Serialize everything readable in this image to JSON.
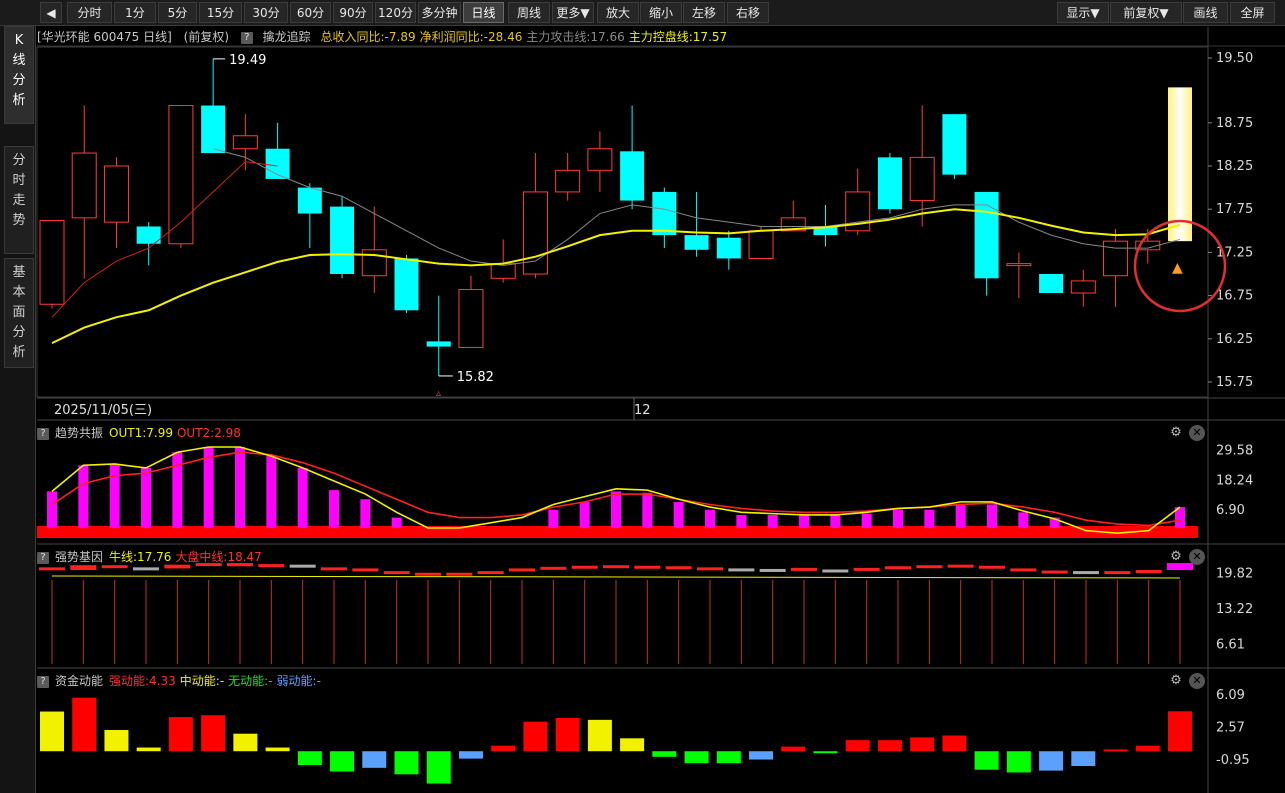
{
  "toolbar": {
    "back_icon": "play-left-icon",
    "periods": [
      "分时",
      "1分",
      "5分",
      "15分",
      "30分",
      "60分",
      "90分",
      "120分",
      "多分钟",
      "日线",
      "周线",
      "更多▼"
    ],
    "active_period": "日线",
    "actions": [
      "放大",
      "缩小",
      "左移",
      "右移"
    ],
    "right": [
      "显示▼",
      "前复权▼",
      "画线",
      "全屏"
    ]
  },
  "sidebar": {
    "tabs": [
      "K线分析",
      "分时走势",
      "基本面分析"
    ],
    "active": "K线分析"
  },
  "main_panel": {
    "title": "[华光环能 600475 日线]",
    "adjust": "(前复权)",
    "indicator_name": "擒龙追踪",
    "items": [
      {
        "label": "总收入同比:-7.89",
        "color": "#e6c619"
      },
      {
        "label": "净利润同比:-28.46",
        "color": "#e6c619"
      },
      {
        "label": "主力攻击线:17.66",
        "color": "#8a8a8a"
      },
      {
        "label": "主力控盘线:17.57",
        "color": "#f2f200"
      }
    ],
    "date_label": "2025/11/05(三)",
    "month_label": "12",
    "high_label": "19.49",
    "low_label": "15.82",
    "y_ticks": [
      "19.50",
      "18.75",
      "18.25",
      "17.75",
      "17.25",
      "16.75",
      "16.25",
      "15.75"
    ]
  },
  "sub1": {
    "name": "趋势共振",
    "items": [
      {
        "label": "OUT1:7.99",
        "color": "#f2f200"
      },
      {
        "label": "OUT2:2.98",
        "color": "#ff3030"
      }
    ],
    "y_ticks": [
      "29.58",
      "18.24",
      "6.90"
    ]
  },
  "sub2": {
    "name": "强势基因",
    "items": [
      {
        "label": "牛线:17.76",
        "color": "#f2f200"
      },
      {
        "label": "大盘中线:18.47",
        "color": "#ff3030"
      }
    ],
    "y_ticks": [
      "19.82",
      "13.22",
      "6.61"
    ]
  },
  "sub3": {
    "name": "资金动能",
    "items": [
      {
        "label": "强动能:4.33",
        "color": "#ff3030"
      },
      {
        "label": "中动能:-",
        "color": "#f2f200"
      },
      {
        "label": "无动能:-",
        "color": "#22dd22"
      },
      {
        "label": "弱动能:-",
        "color": "#5aa0ff"
      }
    ],
    "y_ticks": [
      "6.09",
      "2.57",
      "-0.95"
    ]
  },
  "chart_data": [
    {
      "type": "candlestick",
      "title": "华光环能 600475 日线",
      "ylim": [
        15.7,
        19.65
      ],
      "y_ticks": [
        19.5,
        18.75,
        18.25,
        17.75,
        17.25,
        16.75,
        16.25,
        15.75
      ],
      "candles": [
        {
          "o": 16.65,
          "c": 17.62,
          "h": 17.62,
          "l": 16.6
        },
        {
          "o": 17.65,
          "c": 18.4,
          "h": 18.95,
          "l": 16.95
        },
        {
          "o": 17.6,
          "c": 18.25,
          "h": 18.35,
          "l": 17.3
        },
        {
          "o": 17.55,
          "c": 17.35,
          "h": 17.6,
          "l": 17.1
        },
        {
          "o": 17.35,
          "c": 18.95,
          "h": 18.95,
          "l": 17.3
        },
        {
          "o": 18.95,
          "c": 18.4,
          "h": 19.49,
          "l": 18.4
        },
        {
          "o": 18.45,
          "c": 18.6,
          "h": 18.85,
          "l": 18.2
        },
        {
          "o": 18.45,
          "c": 18.1,
          "h": 18.75,
          "l": 18.1
        },
        {
          "o": 18.0,
          "c": 17.7,
          "h": 18.05,
          "l": 17.3
        },
        {
          "o": 17.78,
          "c": 17.0,
          "h": 17.9,
          "l": 16.95
        },
        {
          "o": 16.98,
          "c": 17.28,
          "h": 17.78,
          "l": 16.78
        },
        {
          "o": 17.18,
          "c": 16.58,
          "h": 17.22,
          "l": 16.55
        },
        {
          "o": 16.22,
          "c": 16.16,
          "h": 16.75,
          "l": 15.82
        },
        {
          "o": 16.15,
          "c": 16.82,
          "h": 16.98,
          "l": 16.15
        },
        {
          "o": 16.95,
          "c": 17.12,
          "h": 17.4,
          "l": 16.9
        },
        {
          "o": 17.0,
          "c": 17.95,
          "h": 18.4,
          "l": 16.95
        },
        {
          "o": 17.95,
          "c": 18.2,
          "h": 18.4,
          "l": 17.85
        },
        {
          "o": 18.2,
          "c": 18.45,
          "h": 18.65,
          "l": 17.95
        },
        {
          "o": 18.42,
          "c": 17.85,
          "h": 18.95,
          "l": 17.75
        },
        {
          "o": 17.95,
          "c": 17.45,
          "h": 18.0,
          "l": 17.3
        },
        {
          "o": 17.45,
          "c": 17.28,
          "h": 17.95,
          "l": 17.2
        },
        {
          "o": 17.42,
          "c": 17.18,
          "h": 17.5,
          "l": 17.05
        },
        {
          "o": 17.18,
          "c": 17.5,
          "h": 17.55,
          "l": 17.18
        },
        {
          "o": 17.5,
          "c": 17.65,
          "h": 17.85,
          "l": 17.5
        },
        {
          "o": 17.55,
          "c": 17.45,
          "h": 17.8,
          "l": 17.32
        },
        {
          "o": 17.5,
          "c": 17.95,
          "h": 18.22,
          "l": 17.45
        },
        {
          "o": 18.35,
          "c": 17.75,
          "h": 18.4,
          "l": 17.7
        },
        {
          "o": 17.85,
          "c": 18.35,
          "h": 18.95,
          "l": 17.55
        },
        {
          "o": 18.85,
          "c": 18.15,
          "h": 18.85,
          "l": 18.1
        },
        {
          "o": 17.95,
          "c": 16.95,
          "h": 17.95,
          "l": 16.75
        },
        {
          "o": 17.12,
          "c": 17.12,
          "h": 17.25,
          "l": 16.72
        },
        {
          "o": 17.0,
          "c": 16.78,
          "h": 17.0,
          "l": 16.78
        },
        {
          "o": 16.78,
          "c": 16.92,
          "h": 17.05,
          "l": 16.62
        },
        {
          "o": 16.98,
          "c": 17.38,
          "h": 17.52,
          "l": 16.62
        },
        {
          "o": 17.28,
          "c": 17.38,
          "h": 17.52,
          "l": 17.12
        },
        {
          "o": 17.38,
          "c": 19.16,
          "h": 19.16,
          "l": 17.38
        }
      ],
      "ma_attack": [
        null,
        null,
        null,
        null,
        null,
        18.45,
        18.35,
        18.15,
        18.0,
        17.9,
        17.7,
        17.5,
        17.3,
        17.15,
        17.1,
        17.15,
        17.4,
        17.7,
        17.8,
        17.75,
        17.65,
        17.6,
        17.55,
        17.55,
        17.55,
        17.6,
        17.65,
        17.75,
        17.8,
        17.8,
        17.6,
        17.45,
        17.35,
        17.3,
        17.3,
        17.4
      ],
      "ma_control": [
        16.2,
        16.38,
        16.5,
        16.58,
        16.75,
        16.9,
        17.02,
        17.14,
        17.22,
        17.23,
        17.22,
        17.17,
        17.12,
        17.1,
        17.12,
        17.2,
        17.32,
        17.45,
        17.5,
        17.5,
        17.48,
        17.47,
        17.5,
        17.52,
        17.54,
        17.58,
        17.63,
        17.7,
        17.75,
        17.72,
        17.65,
        17.56,
        17.48,
        17.45,
        17.46,
        17.57
      ]
    },
    {
      "type": "bar",
      "title": "趋势共振",
      "ylim": [
        0,
        33
      ],
      "values": [
        14,
        24,
        24.5,
        23,
        29,
        31,
        31,
        27.5,
        23,
        14.5,
        11,
        4,
        2,
        2,
        2,
        2,
        7,
        10,
        14,
        13.5,
        10,
        7,
        5,
        5,
        5,
        5,
        5.5,
        7,
        7,
        9,
        9,
        6,
        4,
        2,
        1,
        2,
        8
      ],
      "out1": [
        14,
        24,
        24.5,
        23,
        29,
        31,
        31,
        27.5,
        23,
        18,
        13,
        6,
        0,
        0,
        2,
        4,
        9,
        12,
        15,
        14.5,
        11,
        8,
        6,
        5.5,
        5,
        5,
        6,
        7.5,
        8,
        10,
        10,
        6.5,
        3.5,
        -1,
        -2,
        -1,
        7.99
      ],
      "out2": [
        9,
        17,
        20,
        21,
        24,
        27,
        29,
        28,
        25,
        21,
        16,
        11,
        6,
        4,
        4,
        5,
        8,
        10,
        13,
        13,
        11,
        9,
        7.5,
        6.5,
        6,
        6,
        6.5,
        7.5,
        8,
        9,
        9.5,
        8,
        6,
        3,
        1.5,
        1,
        2.98
      ]
    },
    {
      "type": "bar",
      "title": "强势基因",
      "ylim": [
        0,
        22
      ],
      "close_bars": [
        20.5,
        21.4,
        21.0,
        20.8,
        21.5,
        21.8,
        21.8,
        21.6,
        21.1,
        20.8,
        20.3,
        20.0,
        19.7,
        20.0,
        20.3,
        20.8,
        21.1,
        21.3,
        21.4,
        21.3,
        21.0,
        20.8,
        20.7,
        20.7,
        20.6,
        20.6,
        20.9,
        21.2,
        21.4,
        21.3,
        20.8,
        20.4,
        20.2,
        20.1,
        20.3,
        20.5,
        21.8
      ],
      "open_bars": [
        21.0,
        20.5,
        21.4,
        21.0,
        20.8,
        21.5,
        21.2,
        21.4,
        21.5,
        21.0,
        20.8,
        20.3,
        20.0,
        19.7,
        20.0,
        20.3,
        20.8,
        21.0,
        21.2,
        21.0,
        21.2,
        21.0,
        20.8,
        20.7,
        20.9,
        20.6,
        20.6,
        20.9,
        21.2,
        21.5,
        21.3,
        20.8,
        20.4,
        20.3,
        20.1,
        20.3,
        20.5
      ]
    },
    {
      "type": "bar",
      "title": "资金动能",
      "ylim": [
        -2.7,
        6.5
      ],
      "values": [
        4.3,
        5.8,
        2.3,
        0.4,
        3.7,
        3.9,
        1.9,
        0.4,
        -1.5,
        -2.2,
        -1.8,
        -2.5,
        -3.5,
        -0.8,
        0.6,
        3.2,
        3.6,
        3.4,
        1.4,
        -0.6,
        -1.3,
        -1.3,
        -0.9,
        0.5,
        -0.2,
        1.2,
        1.2,
        1.5,
        1.7,
        -2.0,
        -2.3,
        -2.1,
        -1.6,
        0.2,
        0.6,
        4.33
      ],
      "colors": [
        "#f2f200",
        "#ff0000",
        "#f2f200",
        "#f2f200",
        "#ff0000",
        "#ff0000",
        "#f2f200",
        "#f2f200",
        "#00ff00",
        "#00ff00",
        "#5aa0ff",
        "#00ff00",
        "#00ff00",
        "#5aa0ff",
        "#ff0000",
        "#ff0000",
        "#ff0000",
        "#f2f200",
        "#f2f200",
        "#00ff00",
        "#00ff00",
        "#00ff00",
        "#5aa0ff",
        "#ff0000",
        "#00ff00",
        "#ff0000",
        "#ff0000",
        "#ff0000",
        "#ff0000",
        "#00ff00",
        "#00ff00",
        "#5aa0ff",
        "#5aa0ff",
        "#ff0000",
        "#ff0000",
        "#ff0000"
      ]
    }
  ]
}
